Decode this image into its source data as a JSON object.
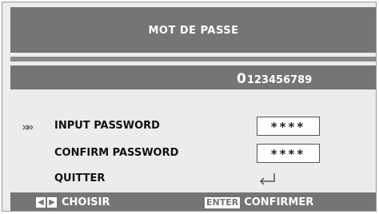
{
  "dialog": {
    "title": "MOT DE PASSE"
  },
  "digit_bar": {
    "first_digit": "0",
    "rest_digits": "123456789"
  },
  "rows": [
    {
      "label": "INPUT PASSWORD",
      "value": "****",
      "selected": true
    },
    {
      "label": "CONFIRM PASSWORD",
      "value": "****"
    },
    {
      "label": "QUITTER",
      "icon": "enter-return-icon"
    }
  ],
  "selector_icon": "double-chevron-right-icon",
  "selector_glyph": "»»",
  "footer": {
    "left_key": "◀",
    "right_key": "▶",
    "nav_label": "CHOISIR",
    "enter_key": "ENTER",
    "confirm_label": "CONFIRMER"
  },
  "colors": {
    "bar": "#757575",
    "background": "#ececec",
    "field": "#ffffff"
  }
}
